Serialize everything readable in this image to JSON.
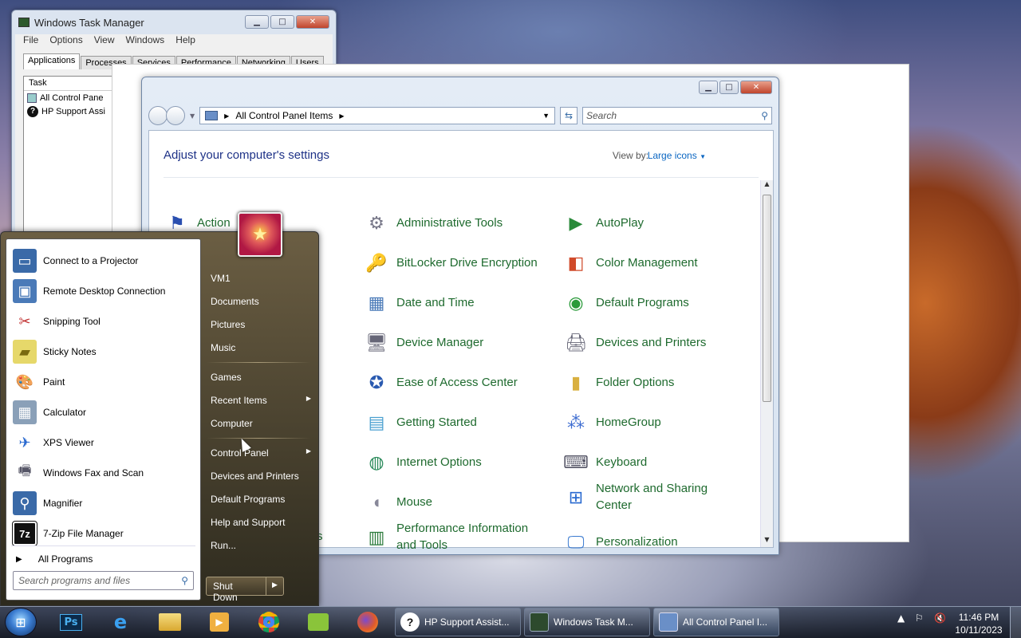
{
  "task_manager": {
    "title": "Windows Task Manager",
    "menu": [
      "File",
      "Options",
      "View",
      "Windows",
      "Help"
    ],
    "tabs": [
      "Applications",
      "Processes",
      "Services",
      "Performance",
      "Networking",
      "Users"
    ],
    "active_tab": "Applications",
    "column_header": "Task",
    "rows": [
      "All Control Pane",
      "HP Support Assi"
    ]
  },
  "control_panel": {
    "address": "All Control Panel Items",
    "search_placeholder": "Search",
    "heading": "Adjust your computer's settings",
    "view_by_label": "View by:",
    "view_by_value": "Large icons",
    "items": [
      {
        "label": "Action",
        "icon": "flag-icon"
      },
      {
        "label": "Administrative Tools",
        "icon": "admin-tools-icon"
      },
      {
        "label": "AutoPlay",
        "icon": "autoplay-icon"
      },
      {
        "label": "BitLocker Drive Encryption",
        "icon": "bitlocker-icon"
      },
      {
        "label": "Color Management",
        "icon": "color-management-icon"
      },
      {
        "label": "Date and Time",
        "icon": "calendar-clock-icon"
      },
      {
        "label": "Default Programs",
        "icon": "default-programs-icon"
      },
      {
        "label": "Device Manager",
        "icon": "device-manager-icon"
      },
      {
        "label": "Devices and Printers",
        "icon": "printer-icon"
      },
      {
        "label": "Ease of Access Center",
        "icon": "ease-of-access-icon"
      },
      {
        "label": "Folder Options",
        "icon": "folder-options-icon"
      },
      {
        "label": "Getting Started",
        "icon": "getting-started-icon"
      },
      {
        "label": "HomeGroup",
        "icon": "homegroup-icon"
      },
      {
        "label": "Internet Options",
        "icon": "internet-options-icon"
      },
      {
        "label": "Keyboard",
        "icon": "keyboard-icon"
      },
      {
        "label": "Mouse",
        "icon": "mouse-icon"
      },
      {
        "label": "Network and Sharing Center",
        "icon": "network-icon"
      },
      {
        "label": "Performance Information and Tools",
        "icon": "performance-icon"
      },
      {
        "label": "Personalization",
        "icon": "personalization-icon"
      }
    ],
    "partial_left_text": "s"
  },
  "start_menu": {
    "programs": [
      {
        "label": "Connect to a Projector",
        "icon": "projector-icon"
      },
      {
        "label": "Remote Desktop Connection",
        "icon": "remote-desktop-icon"
      },
      {
        "label": "Snipping Tool",
        "icon": "scissors-icon"
      },
      {
        "label": "Sticky Notes",
        "icon": "sticky-notes-icon"
      },
      {
        "label": "Paint",
        "icon": "paint-icon"
      },
      {
        "label": "Calculator",
        "icon": "calculator-icon"
      },
      {
        "label": "XPS Viewer",
        "icon": "xps-viewer-icon"
      },
      {
        "label": "Windows Fax and Scan",
        "icon": "fax-icon"
      },
      {
        "label": "Magnifier",
        "icon": "magnifier-icon"
      },
      {
        "label": "7-Zip File Manager",
        "icon": "7zip-icon"
      }
    ],
    "all_programs": "All Programs",
    "search_placeholder": "Search programs and files",
    "right_links": [
      "VM1",
      "Documents",
      "Pictures",
      "Music",
      "Games",
      "Recent Items",
      "Computer",
      "Control Panel",
      "Devices and Printers",
      "Default Programs",
      "Help and Support",
      "Run..."
    ],
    "shutdown": "Shut Down"
  },
  "taskbar": {
    "pinned": [
      "ps-icon",
      "ie-icon",
      "explorer-icon",
      "media-player-icon",
      "chrome-icon",
      "app-icon",
      "firefox-icon"
    ],
    "tasks": [
      {
        "label": "HP Support Assist...",
        "icon": "help-icon"
      },
      {
        "label": "Windows Task M...",
        "icon": "task-manager-icon"
      },
      {
        "label": "All Control Panel I...",
        "icon": "control-panel-icon"
      }
    ],
    "time": "11:46 PM",
    "date": "10/11/2023"
  }
}
